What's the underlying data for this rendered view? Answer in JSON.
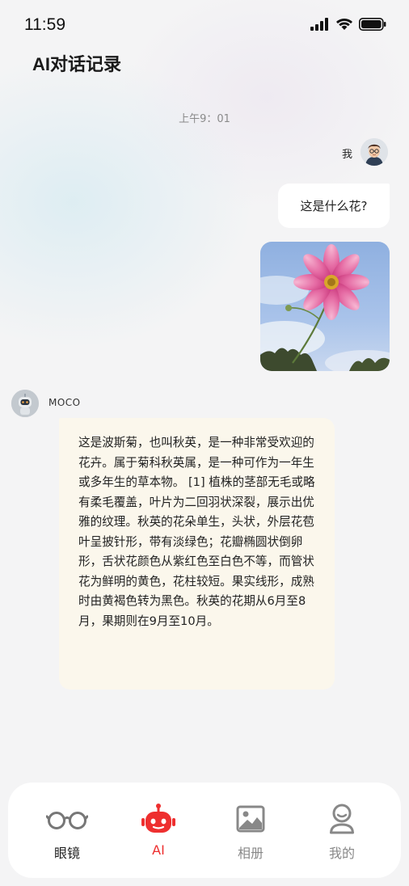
{
  "status_bar": {
    "time": "11:59"
  },
  "header": {
    "title": "AI对话记录"
  },
  "chat": {
    "timestamp": "上午9：01",
    "user": {
      "name": "我",
      "message": "这是什么花?",
      "image_alt": "pink-cosmos-flower-photo"
    },
    "bot": {
      "name": "MOCO",
      "message": "这是波斯菊，也叫秋英，是一种非常受欢迎的花卉。属于菊科秋英属，是一种可作为一年生或多年生的草本物。 [1] 植株的茎部无毛或略有柔毛覆盖，叶片为二回羽状深裂，展示出优雅的纹理。秋英的花朵单生，头状，外层花苞叶呈披针形，带有淡绿色；花瓣椭圆状倒卵形，舌状花颜色从紫红色至白色不等，而管状花为鲜明的黄色，花柱较短。果实线形，成熟时由黄褐色转为黑色。秋英的花期从6月至8月，果期则在9月至10月。"
    }
  },
  "tab_bar": {
    "tabs": [
      {
        "label": "眼镜",
        "icon": "glasses-icon"
      },
      {
        "label": "AI",
        "icon": "robot-icon"
      },
      {
        "label": "相册",
        "icon": "photo-album-icon"
      },
      {
        "label": "我的",
        "icon": "profile-icon"
      }
    ]
  },
  "colors": {
    "accent_red": "#ee2f2f",
    "bot_bubble": "#fbf7ec",
    "user_bubble": "#ffffff",
    "inactive_tab": "#888888"
  }
}
